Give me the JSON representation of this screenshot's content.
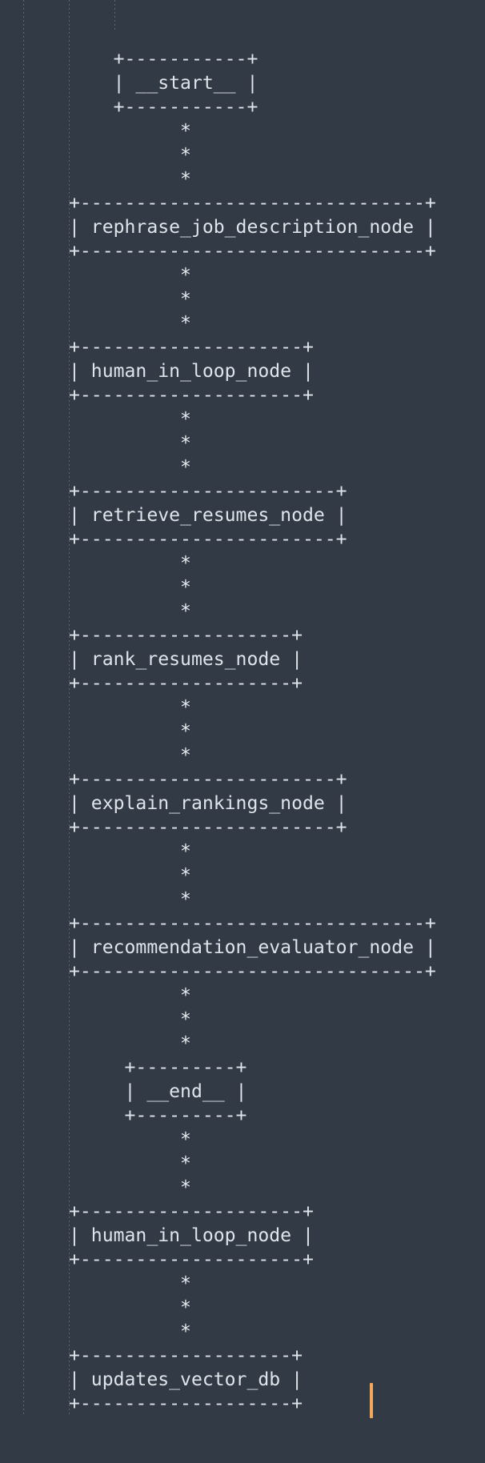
{
  "diagram": {
    "nodes": [
      "__start__",
      "rephrase_job_description_node",
      "human_in_loop_node",
      "retrieve_resumes_node",
      "rank_resumes_node",
      "explain_rankings_node",
      "recommendation_evaluator_node",
      "__end__",
      "human_in_loop_node",
      "updates_vector_db"
    ],
    "edge_glyph": "*"
  },
  "colors": {
    "background": "#323a45",
    "text": "#dfe3ea",
    "guide": "#6b7380",
    "cursor": "#f0a85a"
  }
}
